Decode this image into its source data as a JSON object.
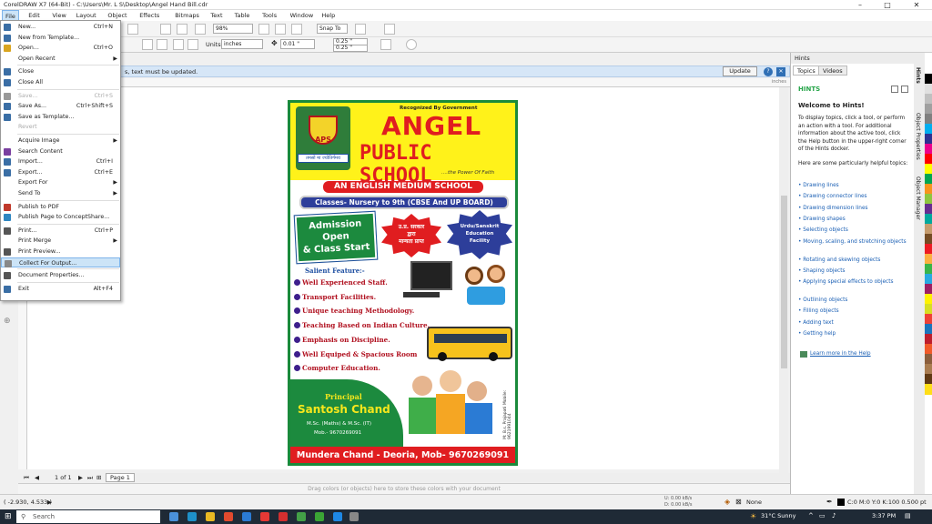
{
  "window": {
    "title": "CorelDRAW X7 (64-Bit) - C:\\Users\\Mr. L S\\Desktop\\Angel Hand Bill.cdr"
  },
  "menubar": [
    "File",
    "Edit",
    "View",
    "Layout",
    "Object",
    "Effects",
    "Bitmaps",
    "Text",
    "Table",
    "Tools",
    "Window",
    "Help"
  ],
  "toolbar": {
    "zoom": "98%",
    "snap": "Snap To",
    "units_label": "Units:",
    "units": "inches",
    "nudge": "0.01 \"",
    "dup_x": "0.25 \"",
    "dup_y": "0.25 \""
  },
  "notification": {
    "text": "s, text must be updated.",
    "update": "Update"
  },
  "ruler_unit": "inches",
  "file_menu": [
    {
      "label": "New...",
      "shortcut": "Ctrl+N",
      "icon": "new-doc-icon",
      "color": "#3a6ea5"
    },
    {
      "label": "New from Template...",
      "shortcut": "",
      "icon": "template-icon",
      "color": "#3a6ea5"
    },
    {
      "label": "Open...",
      "shortcut": "Ctrl+O",
      "icon": "open-icon",
      "color": "#d9a520"
    },
    {
      "label": "Open Recent",
      "shortcut": "",
      "arrow": true
    },
    {
      "sep": true
    },
    {
      "label": "Close",
      "shortcut": "",
      "icon": "close-doc-icon",
      "color": "#3a6ea5"
    },
    {
      "label": "Close All",
      "shortcut": "",
      "icon": "close-all-icon",
      "color": "#3a6ea5"
    },
    {
      "sep": true
    },
    {
      "label": "Save...",
      "shortcut": "Ctrl+S",
      "disabled": true,
      "icon": "save-icon",
      "color": "#999"
    },
    {
      "label": "Save As...",
      "shortcut": "Ctrl+Shift+S",
      "icon": "save-as-icon",
      "color": "#3a6ea5"
    },
    {
      "label": "Save as Template...",
      "shortcut": "",
      "icon": "save-template-icon",
      "color": "#3a6ea5"
    },
    {
      "label": "Revert",
      "shortcut": "",
      "disabled": true
    },
    {
      "sep": true
    },
    {
      "label": "Acquire Image",
      "shortcut": "",
      "arrow": true
    },
    {
      "label": "Search Content",
      "shortcut": "",
      "icon": "search-content-icon",
      "color": "#7a3fa0"
    },
    {
      "label": "Import...",
      "shortcut": "Ctrl+I",
      "icon": "import-icon",
      "color": "#3a6ea5"
    },
    {
      "label": "Export...",
      "shortcut": "Ctrl+E",
      "icon": "export-icon",
      "color": "#3a6ea5"
    },
    {
      "label": "Export For",
      "shortcut": "",
      "arrow": true
    },
    {
      "label": "Send To",
      "shortcut": "",
      "arrow": true
    },
    {
      "sep": true
    },
    {
      "label": "Publish to PDF",
      "shortcut": "",
      "icon": "pdf-icon",
      "color": "#c0392b"
    },
    {
      "label": "Publish Page to ConceptShare...",
      "shortcut": "",
      "icon": "conceptshare-icon",
      "color": "#2e86c1"
    },
    {
      "sep": true
    },
    {
      "label": "Print...",
      "shortcut": "Ctrl+P",
      "icon": "print-icon",
      "color": "#555"
    },
    {
      "label": "Print Merge",
      "shortcut": "",
      "arrow": true
    },
    {
      "label": "Print Preview...",
      "shortcut": "",
      "icon": "print-preview-icon",
      "color": "#555"
    },
    {
      "label": "Collect For Output...",
      "shortcut": "",
      "highlight": true,
      "icon": "collect-icon",
      "color": "#888"
    },
    {
      "sep": true
    },
    {
      "label": "Document Properties...",
      "shortcut": "",
      "icon": "doc-properties-icon",
      "color": "#555"
    },
    {
      "sep": true
    },
    {
      "label": "Exit",
      "shortcut": "Alt+F4",
      "icon": "exit-icon",
      "color": "#3a6ea5"
    }
  ],
  "flyer": {
    "recognized": "Recognized By Government",
    "school1": "ANGEL",
    "school2": "PUBLIC SCHOOL",
    "tagline": "....the Power Of Faith",
    "logo_text": "APS",
    "logo_motto": "तमसो मा ज्योतिर्गमय",
    "medium": "AN ENGLISH MEDIUM SCHOOL",
    "classes": "Classes- Nursery to 9th (CBSE And UP BOARD)",
    "admission": [
      "Admission",
      "Open",
      "& Class Start"
    ],
    "hindi_badge": [
      "उ.प्र. सरकार",
      "द्वारा",
      "मान्यता प्राप्त"
    ],
    "urdu_badge": [
      "Urdu/Sanskrit",
      "Education",
      "Facility"
    ],
    "salient": "Salient Feature:-",
    "features": [
      "Well Experienced Staff.",
      "Transport Facilities.",
      "Unique teaching Methodology.",
      "Teaching Based on Indian Culture.",
      "Emphasis on Discipline.",
      "Well Equiped & Spacious Room",
      "Computer Education."
    ],
    "principal_label": "Principal",
    "principal_name": "Santosh Chand",
    "principal_qual": "M.Sc. (Maths) & M.Sc. (IT)",
    "principal_mob": "Mob.- 9670269091",
    "footer": "Mundera Chand - Deoria, Mob- 9670269091",
    "side_text": [
      "M: B.s. Prajapati",
      "Mobile: 9621991044"
    ]
  },
  "page_nav": {
    "counter": "1 of 1",
    "page_tab": "Page 1"
  },
  "palette_hint": "Drag colors (or objects) here to store these colors with your document",
  "hints": {
    "header": "Hints",
    "tabs": [
      "Topics",
      "Videos"
    ],
    "title": "HINTS",
    "welcome": "Welcome to Hints!",
    "intro": "To display topics, click a tool, or perform an action with a tool. For additional information about the active tool, click the Help button in the upper-right corner of the Hints docker.",
    "helpful": "Here are some particularly helpful topics:",
    "topics": [
      "Drawing lines",
      "Drawing connector lines",
      "Drawing dimension lines",
      "Drawing shapes",
      "Selecting objects",
      "Moving, scaling, and stretching objects",
      "Rotating and skewing objects",
      "Shaping objects",
      "Applying special effects to objects",
      "Outlining objects",
      "Filling objects",
      "Adding text",
      "Getting help"
    ],
    "learn_more": "Learn more in the Help"
  },
  "dock_tabs": [
    "Hints",
    "Object Properties",
    "Object Manager"
  ],
  "palette_colors": [
    "#ffffff",
    "#000000",
    "#e0e0e0",
    "#c0c0c0",
    "#a0a0a0",
    "#808080",
    "#00aeef",
    "#2e3192",
    "#ec008c",
    "#ff0000",
    "#ffff00",
    "#00a651",
    "#f7941d",
    "#8dc63f",
    "#662d91",
    "#00a99d",
    "#c69c6d",
    "#754c24",
    "#ed1c24",
    "#fbb040",
    "#39b54a",
    "#27aae1",
    "#9e1f63",
    "#fff200",
    "#d7df23",
    "#ef4136",
    "#1b75bc",
    "#be1e2d",
    "#f15a29",
    "#8b5e3c",
    "#a97c50",
    "#603913",
    "#ffde17"
  ],
  "status": {
    "coords": "( -2.930, 4.533 )",
    "speed1": "0.00 kB/s",
    "speed2": "0.00 kB/s",
    "fill": "None",
    "outline": "C:0 M:0 Y:0 K:100  0.500 pt"
  },
  "taskbar": {
    "search": "Search",
    "weather": "31°C  Sunny",
    "time": "3:37 PM"
  }
}
